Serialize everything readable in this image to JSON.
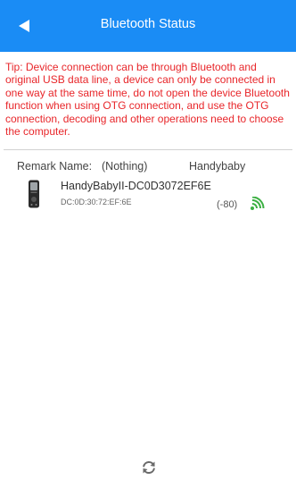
{
  "header": {
    "title": "Bluetooth Status",
    "background_color": "#1a8cf5"
  },
  "tip": {
    "text": "Tip: Device connection can be through Bluetooth and original USB data line, a device can only be connected in one way at the same time, do not open the device Bluetooth function when using OTG connection, and use the OTG connection, decoding and other operations need to choose the computer.",
    "color": "#e8262a"
  },
  "remark": {
    "label": "Remark Name:",
    "value": "(Nothing)",
    "device_name": "Handybaby"
  },
  "devices": [
    {
      "name": "HandyBabyII-DC0D3072EF6E",
      "mac": "DC:0D:30:72:EF:6E",
      "rssi": "(-80)",
      "icon": "key-programmer-device-icon",
      "signal_icon": "wifi-signal-icon",
      "signal_color": "#3cb043"
    }
  ],
  "footer": {
    "refresh_icon": "refresh-icon"
  }
}
